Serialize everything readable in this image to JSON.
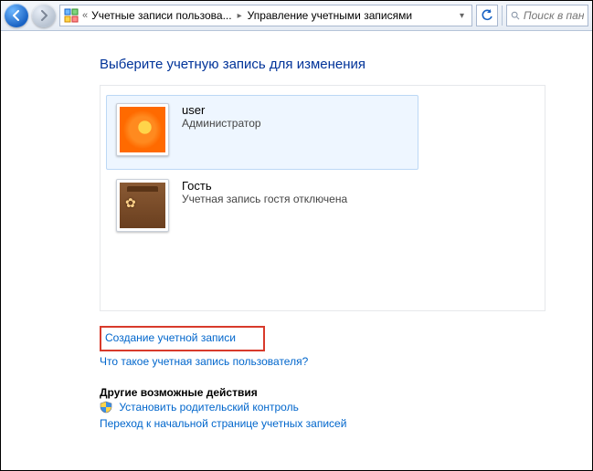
{
  "breadcrumb": {
    "segment1": "Учетные записи пользова...",
    "segment2": "Управление учетными записями"
  },
  "search": {
    "placeholder": "Поиск в панели"
  },
  "page": {
    "title": "Выберите учетную запись для изменения"
  },
  "accounts": {
    "user": {
      "name": "user",
      "role": "Администратор"
    },
    "guest": {
      "name": "Гость",
      "status": "Учетная запись гостя отключена"
    }
  },
  "links": {
    "create_account": "Создание учетной записи",
    "what_is_account": "Что такое учетная запись пользователя?",
    "other_actions_heading": "Другие возможные действия",
    "parental_controls": "Установить родительский контроль",
    "go_home": "Переход к начальной странице учетных записей"
  }
}
